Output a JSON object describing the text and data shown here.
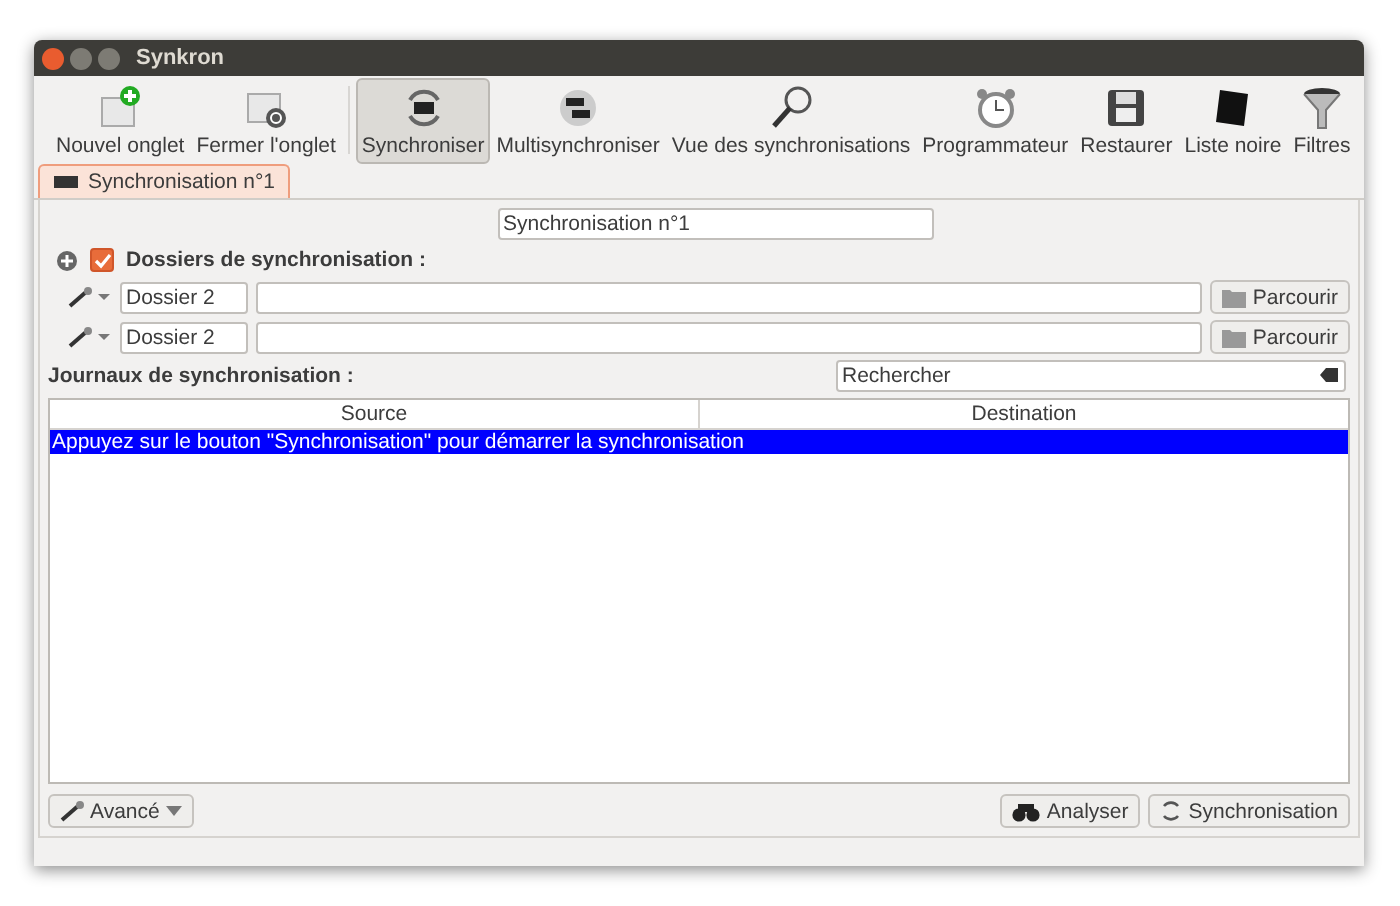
{
  "window": {
    "title": "Synkron"
  },
  "toolbar": [
    {
      "label": "Nouvel onglet",
      "selected": false
    },
    {
      "label": "Fermer l'onglet",
      "selected": false
    },
    {
      "label": "Synchroniser",
      "selected": true
    },
    {
      "label": "Multisynchroniser",
      "selected": false
    },
    {
      "label": "Vue des synchronisations",
      "selected": false
    },
    {
      "label": "Programmateur",
      "selected": false
    },
    {
      "label": "Restaurer",
      "selected": false
    },
    {
      "label": "Liste noire",
      "selected": false
    },
    {
      "label": "Filtres",
      "selected": false
    }
  ],
  "tabs": [
    {
      "label": "Synchronisation n°1",
      "selected": true
    }
  ],
  "sync_name": "Synchronisation n°1",
  "folders_section": {
    "label": "Dossiers de synchronisation :",
    "checked": true
  },
  "folders": [
    {
      "name": "Dossier 2",
      "browse": "Parcourir"
    },
    {
      "name": "Dossier 2",
      "browse": "Parcourir"
    }
  ],
  "logs_label": "Journaux de synchronisation :",
  "search": {
    "placeholder": "Rechercher"
  },
  "table": {
    "columns": [
      "Source",
      "Destination"
    ],
    "rows": [
      {
        "text": "Appuyez sur le bouton \"Synchronisation\" pour démarrer la synchronisation",
        "selected": true
      }
    ]
  },
  "buttons": {
    "advanced": "Avancé",
    "analyse": "Analyser",
    "sync": "Synchronisation"
  }
}
